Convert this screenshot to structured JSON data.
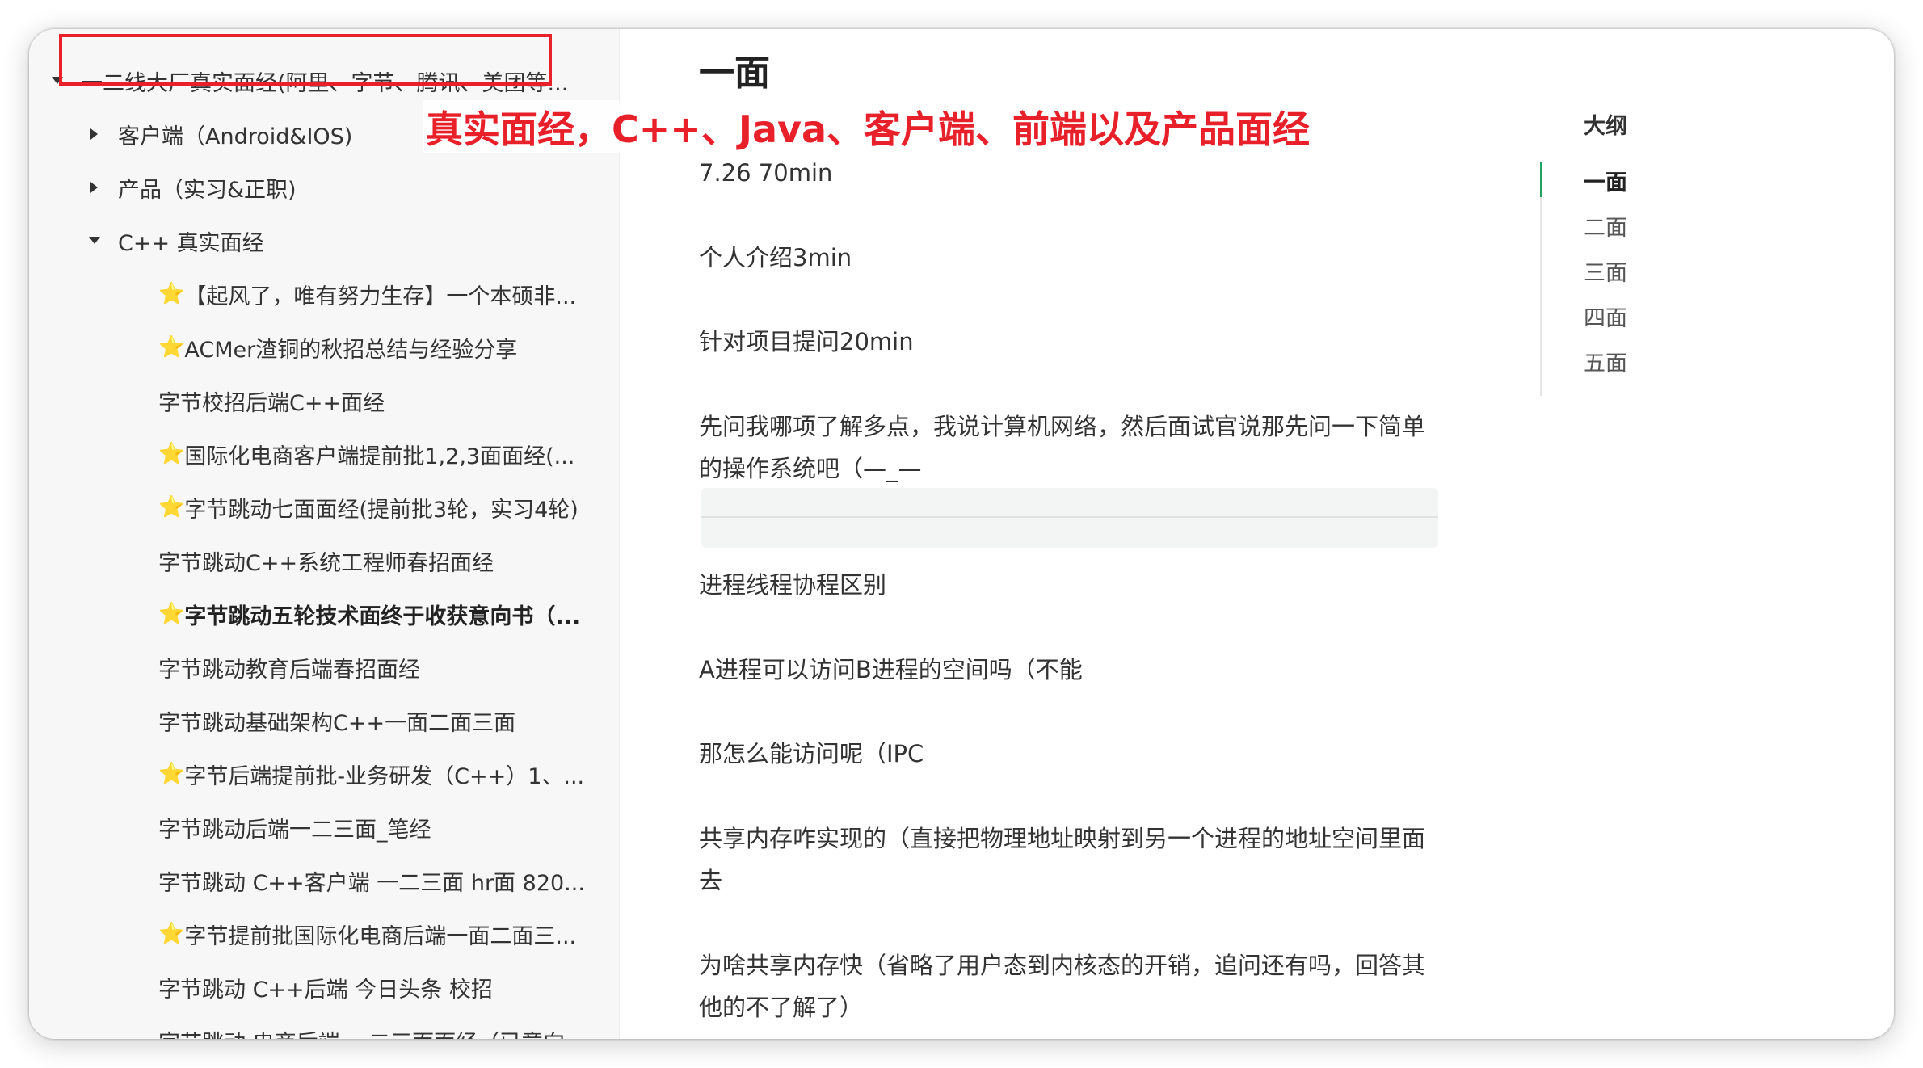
{
  "sidebar": {
    "root": {
      "label": "一二线大厂真实面经(阿里、字节、腾讯、美团等..."
    },
    "groups": [
      {
        "label": "客户端（Android&IOS)"
      },
      {
        "label": "产品（实习&正职)"
      },
      {
        "label": "C++ 真实面经"
      }
    ],
    "items": [
      {
        "label": "【起风了，唯有努力生存】一个本硕非...",
        "starred": true
      },
      {
        "label": "ACMer渣铜的秋招总结与经验分享",
        "starred": true
      },
      {
        "label": "字节校招后端C++面经",
        "starred": false
      },
      {
        "label": "国际化电商客户端提前批1,2,3面面经(...",
        "starred": true
      },
      {
        "label": "字节跳动七面面经(提前批3轮，实习4轮)",
        "starred": true
      },
      {
        "label": "字节跳动C++系统工程师春招面经",
        "starred": false
      },
      {
        "label": "字节跳动五轮技术面终于收获意向书（...",
        "starred": true
      },
      {
        "label": "字节跳动教育后端春招面经",
        "starred": false
      },
      {
        "label": "字节跳动基础架构C++一面二面三面",
        "starred": false
      },
      {
        "label": "字节后端提前批-业务研发（C++）1、...",
        "starred": true
      },
      {
        "label": "字节跳动后端一二三面_笔经",
        "starred": false
      },
      {
        "label": "字节跳动 C++客户端 一二三面 hr面 820...",
        "starred": false
      },
      {
        "label": "字节提前批国际化电商后端一面二面三...",
        "starred": true
      },
      {
        "label": "字节跳动 C++后端 今日头条 校招",
        "starred": false
      },
      {
        "label": "字节跳动 电商后端 一二三面面经（已意向...",
        "starred": false
      }
    ],
    "star_glyph": "⭐"
  },
  "annotation": {
    "text": "真实面经，C++、Java、客户端、前端以及产品面经",
    "color": "#e8202a"
  },
  "document": {
    "title": "一面",
    "paragraphs": [
      "7.26 70min",
      "个人介绍3min",
      "针对项目提问20min",
      "先问我哪项了解多点，我说计算机网络，然后面试官说那先问一下简单的操作系统吧（—_—",
      "进程线程协程区别",
      "A进程可以访问B进程的空间吗（不能",
      "那怎么能访问呢（IPC",
      "共享内存咋实现的（直接把物理地址映射到另一个进程的地址空间里面去",
      "为啥共享内存快（省略了用户态到内核态的开销，追问还有吗，回答其他的不了解了）"
    ]
  },
  "outline": {
    "title": "大纲",
    "items": [
      "一面",
      "二面",
      "三面",
      "四面",
      "五面"
    ],
    "active_index": 0,
    "accent_color": "#22a15f"
  }
}
